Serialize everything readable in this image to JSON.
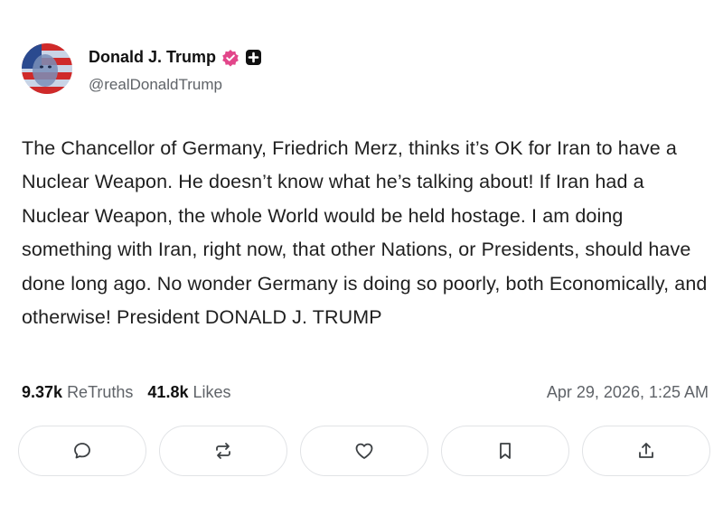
{
  "author": {
    "display_name": "Donald J. Trump",
    "handle": "@realDonaldTrump",
    "verified_color": "#e2468a"
  },
  "post": {
    "text": "The Chancellor of Germany, Friedrich Merz, thinks it’s OK for Iran to have a Nuclear Weapon. He doesn’t know what he’s talking about! If Iran had a Nuclear Weapon, the whole World would be held hostage. I am doing something with Iran, right now, that other Nations, or Presidents, should have done long ago. No wonder Germany is doing so poorly, both Economically, and otherwise! President DONALD J. TRUMP"
  },
  "stats": {
    "retruths_count": "9.37k",
    "retruths_label": "ReTruths",
    "likes_count": "41.8k",
    "likes_label": "Likes"
  },
  "timestamp": "Apr 29, 2026, 1:25 AM",
  "actions": [
    {
      "icon": "reply-icon"
    },
    {
      "icon": "retruth-icon"
    },
    {
      "icon": "like-icon"
    },
    {
      "icon": "bookmark-icon"
    },
    {
      "icon": "share-icon"
    }
  ]
}
